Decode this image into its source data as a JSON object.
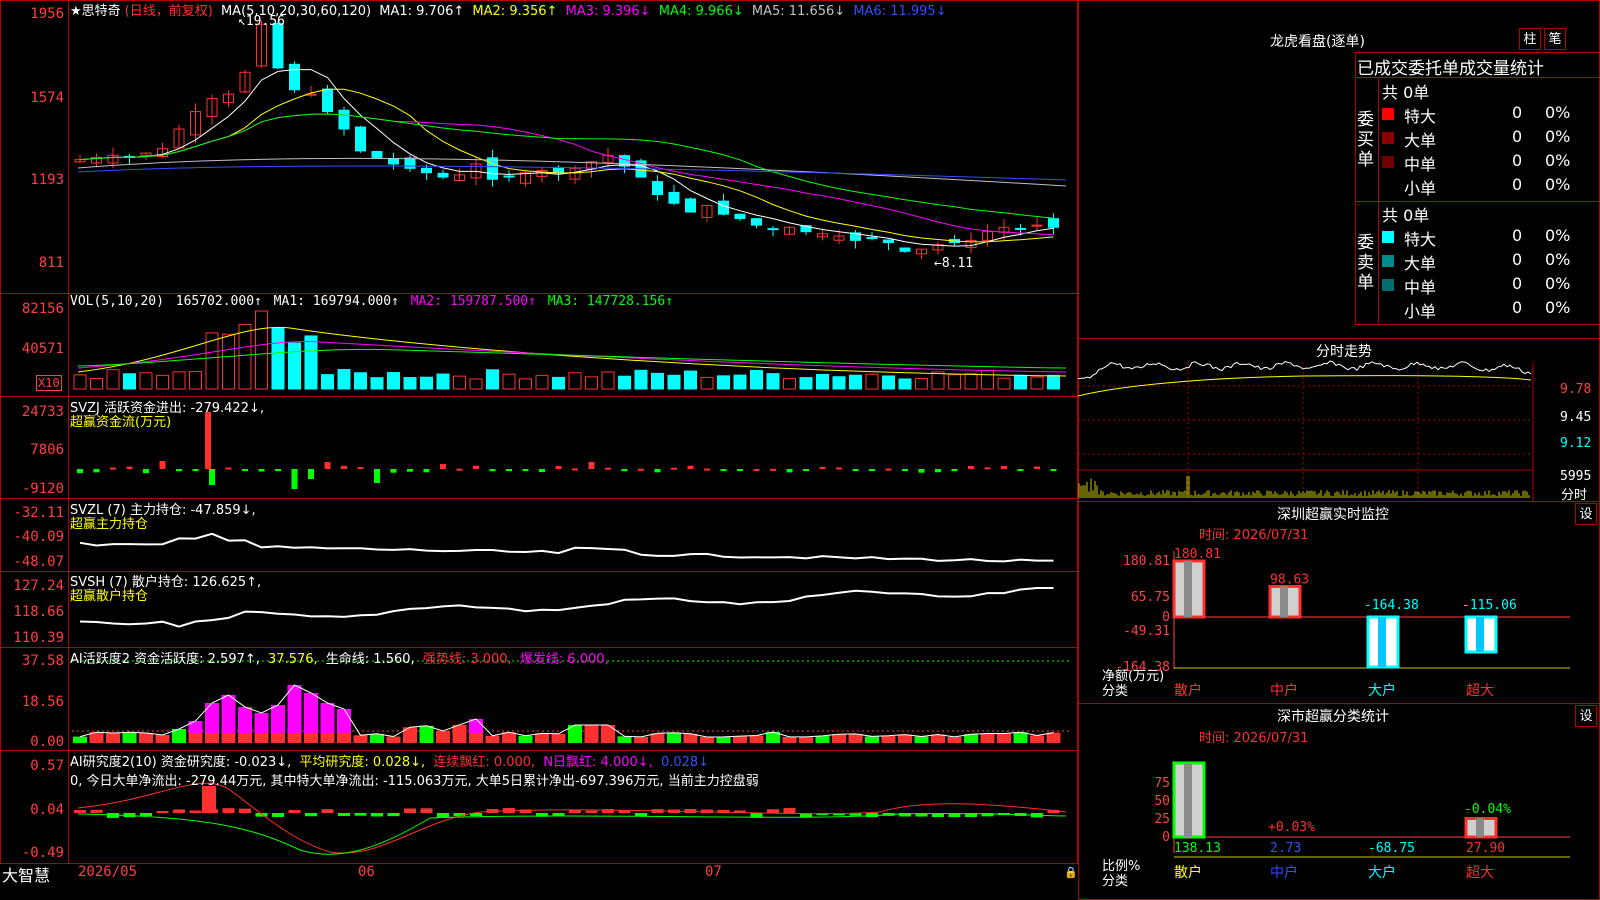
{
  "app": {
    "brand": "大智慧"
  },
  "kline": {
    "title": "★思特奇",
    "subtitle": "(日线，前复权)",
    "ma_label": "MA(5,10,20,30,60,120)",
    "ma1": "MA1: 9.706↑",
    "ma2": "MA2: 9.356↑",
    "ma3": "MA3: 9.396↓",
    "ma4": "MA4: 9.966↓",
    "ma5": "MA5: 11.656↓",
    "ma6": "MA6: 11.995↓",
    "high_marker": "19.56",
    "low_marker": "8.11",
    "y_ticks": [
      "1956",
      "1574",
      "1193",
      "811"
    ]
  },
  "vol": {
    "label": "VOL(5,10,20)",
    "value": "165702.000↑",
    "ma1": "MA1: 169794.000↑",
    "ma2": "MA2: 159787.500↑",
    "ma3": "MA3: 147728.156↑",
    "y_ticks": [
      "82156",
      "40571"
    ],
    "unit": "X10"
  },
  "svzj": {
    "label": "SVZJ  活跃资金进出: -279.422↓,",
    "sub": "超赢资金流(万元)",
    "y_ticks": [
      "24733",
      "7806",
      "-9120"
    ]
  },
  "svzl": {
    "label": "SVZL (7) 主力持仓: -47.859↓,",
    "sub": "超赢主力持仓",
    "y_ticks": [
      "-32.11",
      "-40.09",
      "-48.07"
    ]
  },
  "svsh": {
    "label": "SVSH (7) 散户持仓: 126.625↑,",
    "sub": "超赢散户持仓",
    "y_ticks": [
      "127.24",
      "118.66",
      "110.39"
    ]
  },
  "ai1": {
    "p1": "AI活跃度2 资金活跃度: 2.597↑,",
    "p2": "37.576,",
    "p3": "生命线: 1.560,",
    "p4": "强势线: 3.000,",
    "p5": "爆发线: 6.000,",
    "y_ticks": [
      "37.58",
      "18.56",
      "0.00"
    ]
  },
  "ai2": {
    "p1": "AI研究度2(10) 资金研究度: -0.023↓,",
    "p2": "平均研究度: 0.028↓,",
    "p3": "连续飘红: 0.000,",
    "p4": "N日飘红: 4.000↓,",
    "p5": "0.028↓",
    "note": "0, 今日大单净流出: -279.44万元, 其中特大单净流出: -115.063万元, 大单5日累计净出-697.396万元, 当前主力控盘弱",
    "y_ticks": [
      "0.57",
      "0.04",
      "-0.49"
    ]
  },
  "xaxis": {
    "labels": [
      "2026/05",
      "06",
      "07"
    ]
  },
  "lhb": {
    "title": "龙虎看盘(逐单)",
    "btn1": "柱",
    "btn2": "笔",
    "tab_header": "已成交委托单成交量统计",
    "buy_label": "委买单",
    "sell_label": "委卖单",
    "buy_total": "共 0单",
    "sell_total": "共 0单",
    "buy_rows": [
      {
        "name": "特大",
        "v1": "0",
        "v2": "0%",
        "color": "#ff0000"
      },
      {
        "name": "大单",
        "v1": "0",
        "v2": "0%",
        "color": "#8b0000"
      },
      {
        "name": "中单",
        "v1": "0",
        "v2": "0%",
        "color": "#6e0000"
      },
      {
        "name": "小单",
        "v1": "0",
        "v2": "0%",
        "color": "#000000"
      }
    ],
    "sell_rows": [
      {
        "name": "特大",
        "v1": "0",
        "v2": "0%",
        "color": "#00ffff"
      },
      {
        "name": "大单",
        "v1": "0",
        "v2": "0%",
        "color": "#008b8b"
      },
      {
        "name": "中单",
        "v1": "0",
        "v2": "0%",
        "color": "#006e6e"
      },
      {
        "name": "小单",
        "v1": "0",
        "v2": "0%",
        "color": "#000000"
      }
    ]
  },
  "intraday": {
    "title": "分时走势",
    "y_ticks": [
      "9.78",
      "9.45",
      "9.12"
    ],
    "vol_tick": "5995",
    "vol_unit": "分时"
  },
  "sz_monitor": {
    "title": "深圳超赢实时监控",
    "btn": "设",
    "time": "时间: 2026/07/31",
    "y_ticks": [
      "180.81",
      "65.75",
      "0",
      "-49.31",
      "-164.38"
    ],
    "unit1": "净额(万元)",
    "unit2": "分类",
    "bars": [
      {
        "cat": "散户",
        "value": 180.81,
        "label": "180.81"
      },
      {
        "cat": "中户",
        "value": 98.63,
        "label": "98.63"
      },
      {
        "cat": "大户",
        "value": -164.38,
        "label": "-164.38"
      },
      {
        "cat": "超大",
        "value": -115.06,
        "label": "-115.06"
      }
    ]
  },
  "sz_class": {
    "title": "深市超赢分类统计",
    "btn": "设",
    "time": "时间: 2026/07/31",
    "y_ticks": [
      "75",
      "50",
      "25",
      "0"
    ],
    "unit1": "比例%",
    "unit2": "分类",
    "bars": [
      {
        "cat": "散户",
        "value": 138.13,
        "label": "138.13",
        "pct": 100,
        "pct_label": ""
      },
      {
        "cat": "中户",
        "value": 2.73,
        "label": "2.73",
        "pct": 0.03,
        "pct_label": "+0.03%"
      },
      {
        "cat": "大户",
        "value": -68.75,
        "label": "-68.75",
        "pct": 0,
        "pct_label": ""
      },
      {
        "cat": "超大",
        "value": 27.9,
        "label": "27.90",
        "pct": 25,
        "pct_label": "-0.04%"
      }
    ]
  },
  "colors": {
    "up": "#ff3030",
    "down": "#00ffff",
    "grid": "#b00000",
    "axis": "#ff4040"
  },
  "chart_data": {
    "type": "candlestick",
    "x": [
      "2026/05",
      "06",
      "07"
    ],
    "y_label_ticks": [
      "1956",
      "1574",
      "1193",
      "811"
    ],
    "high": 19.56,
    "low": 8.11,
    "ma": {
      "MA1": 9.706,
      "MA2": 9.356,
      "MA3": 9.396,
      "MA4": 9.966,
      "MA5": 11.656,
      "MA6": 11.995
    },
    "volume": 165702.0
  }
}
